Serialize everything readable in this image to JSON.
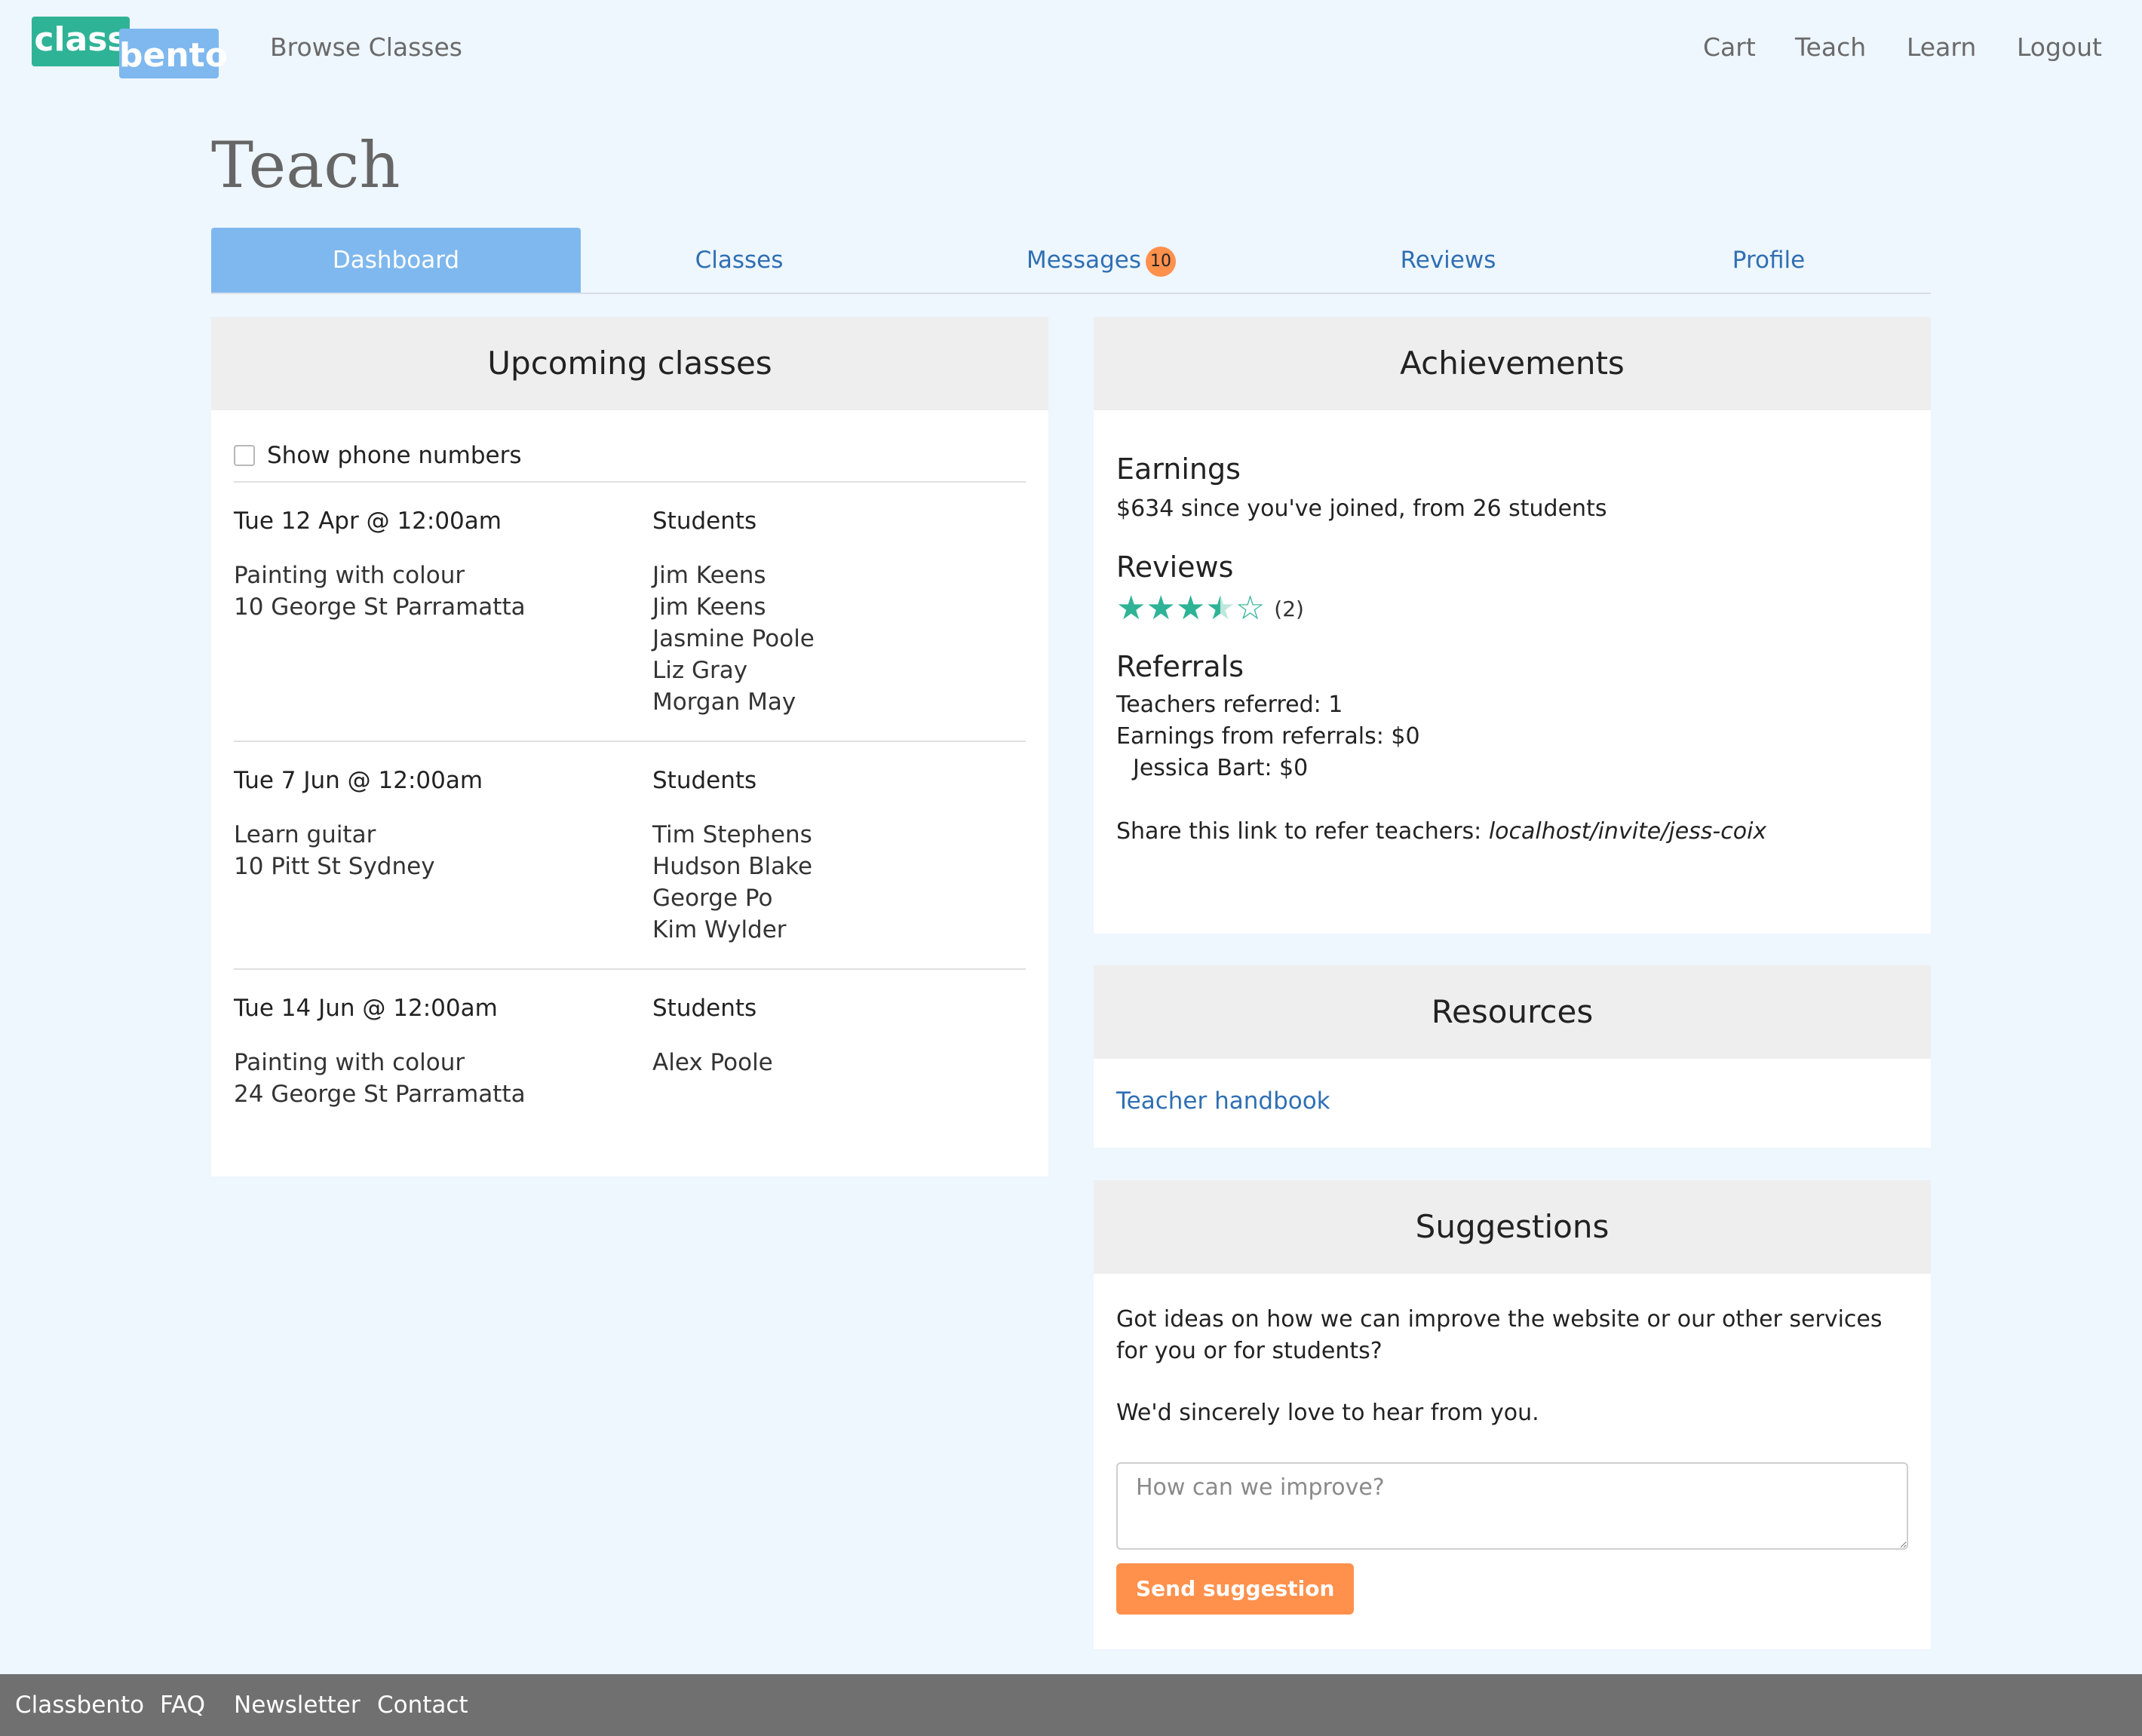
{
  "header": {
    "logo_class": "class",
    "logo_bento": "bento",
    "browse": "Browse Classes",
    "nav": [
      "Cart",
      "Teach",
      "Learn",
      "Logout"
    ]
  },
  "page": {
    "title": "Teach"
  },
  "tabs": [
    {
      "label": "Dashboard",
      "active": true
    },
    {
      "label": "Classes"
    },
    {
      "label": "Messages",
      "badge": "10"
    },
    {
      "label": "Reviews"
    },
    {
      "label": "Profile"
    }
  ],
  "upcoming": {
    "title": "Upcoming classes",
    "show_phone_label": "Show phone numbers",
    "students_label": "Students",
    "classes": [
      {
        "date": "Tue 12 Apr @ 12:00am",
        "name": "Painting with colour",
        "location": "10 George St Parramatta",
        "students": [
          "Jim Keens",
          "Jim Keens",
          "Jasmine Poole",
          "Liz Gray",
          "Morgan May"
        ]
      },
      {
        "date": "Tue 7 Jun @ 12:00am",
        "name": "Learn guitar",
        "location": "10 Pitt St Sydney",
        "students": [
          "Tim Stephens",
          "Hudson Blake",
          "George Po",
          "Kim Wylder"
        ]
      },
      {
        "date": "Tue 14 Jun @ 12:00am",
        "name": "Painting with colour",
        "location": "24 George St Parramatta",
        "students": [
          "Alex Poole"
        ]
      }
    ]
  },
  "achievements": {
    "title": "Achievements",
    "earnings_heading": "Earnings",
    "earnings_amount": "$634",
    "earnings_text": " since you've joined, from 26 students",
    "reviews_heading": "Reviews",
    "rating": 3.5,
    "rating_max": 5,
    "review_count": "(2)",
    "referrals_heading": "Referrals",
    "teachers_referred": "Teachers referred: 1",
    "earnings_from_referrals": "Earnings from referrals: $0",
    "referral_entry": "Jessica Bart: $0",
    "share_text": "Share this link to refer teachers: ",
    "share_link": "localhost/invite/jess-coix"
  },
  "resources": {
    "title": "Resources",
    "handbook": "Teacher handbook"
  },
  "suggestions": {
    "title": "Suggestions",
    "text1": "Got ideas on how we can improve the website or our other services for you or for students?",
    "text2": "We'd sincerely love to hear from you.",
    "placeholder": "How can we improve?",
    "button": "Send suggestion"
  },
  "footer": {
    "links": [
      "Classbento",
      "FAQ",
      "Newsletter",
      "Contact"
    ]
  },
  "colors": {
    "accent": "#7fb8ee",
    "brand_green": "#2fb396",
    "cta": "#ff914d",
    "bg": "#eef6fe"
  }
}
